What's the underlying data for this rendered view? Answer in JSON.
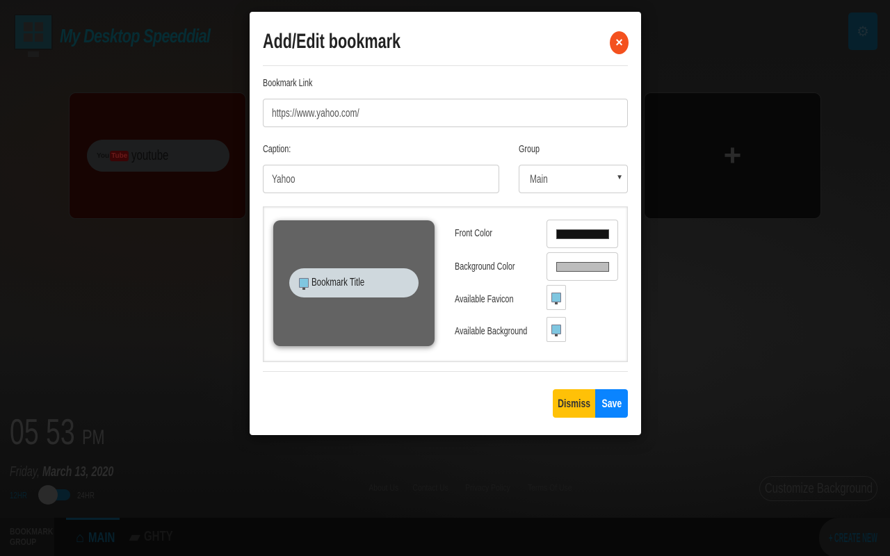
{
  "background": {
    "brand_title": "My Desktop Speeddial",
    "settings_icon": "gears-icon",
    "tiles": [
      {
        "label": "youtube",
        "logo": "YouTube",
        "logo_you": "You",
        "logo_tube": "Tube"
      },
      {
        "label": "+",
        "type": "add-bookmark"
      }
    ],
    "clock": {
      "time": "05 53",
      "ampm": "PM"
    },
    "date": {
      "weekday": "Friday",
      "separator": ", ",
      "full_date": "March 13, 2020"
    },
    "hour_format": {
      "left": "12HR",
      "right": "24HR",
      "selected": "12HR"
    },
    "footer_links": [
      "About Us",
      "Contact Us",
      "Privacy Policy",
      "Terms Of Use"
    ],
    "customize_button": "Customize Background",
    "bookmark_group_label_line1": "BOOKMARK",
    "bookmark_group_label_line2": "GROUP",
    "groups": [
      {
        "label": "MAIN",
        "icon": "home-icon",
        "active": true
      },
      {
        "label": "GHTY",
        "icon": "folder-icon",
        "active": false
      }
    ],
    "create_new": "CREATE NEW",
    "create_new_icon": "+"
  },
  "modal": {
    "title": "Add/Edit bookmark",
    "close_icon": "×",
    "bookmark_link_label": "Bookmark Link",
    "bookmark_link_value": "https://www.yahoo.com/",
    "caption_label": "Caption:",
    "caption_value": "Yahoo",
    "group_label": "Group",
    "group_value": "Main",
    "select_arrow": "▼",
    "preview_title": "Bookmark Title",
    "front_color_label": "Front Color",
    "front_color": "#111111",
    "background_color_label": "Background Color",
    "background_color": "#bdbdbd",
    "favicon_label": "Available Favicon",
    "background_label": "Available Background",
    "dismiss_label": "Dismiss",
    "save_label": "Save",
    "colors": {
      "close": "#f4511e",
      "dismiss": "#ffc107",
      "save": "#0a84ff",
      "preview_card": "#636363",
      "preview_pill": "#cfd8dd"
    }
  }
}
